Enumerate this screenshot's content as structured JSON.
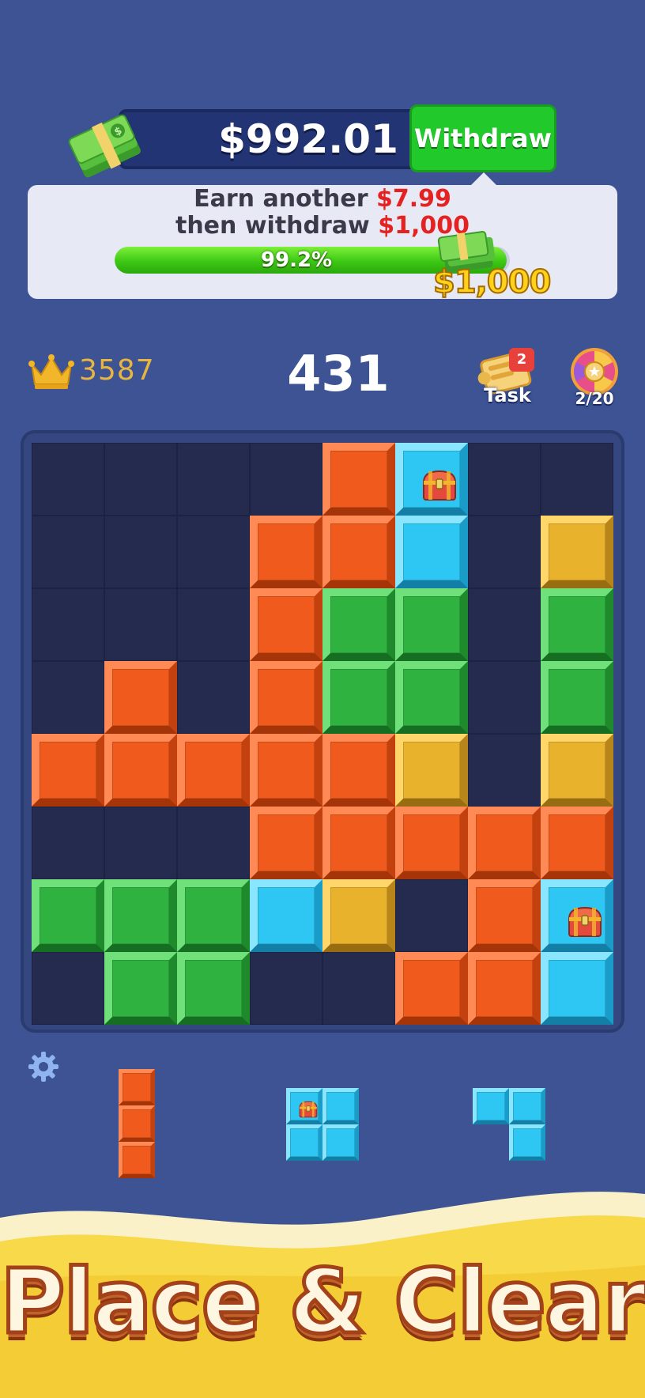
{
  "wallet": {
    "balance": "$992.01",
    "withdraw_label": "Withdraw"
  },
  "progress": {
    "line1_prefix": "Earn another",
    "line1_amount": "$7.99",
    "line2_prefix": "then withdraw",
    "line2_amount": "$1,000",
    "percent_label": "99.2%",
    "percent_value": 0.992,
    "goal_label": "$1,000"
  },
  "scores": {
    "best": "3587",
    "current": "431"
  },
  "task": {
    "label": "Task",
    "badge_count": "2"
  },
  "spin": {
    "label": "2/20"
  },
  "colors": {
    "background": "#3e5393",
    "board": "#242b4e",
    "orange": "#f05a1c",
    "blue": "#2ec6f2",
    "green": "#2fb23f",
    "yellow": "#e8b22c",
    "accent_green": "#21c92a",
    "text_red": "#e52222"
  },
  "board": {
    "rows": 8,
    "cols": 8,
    "legend": "O=orange, B=blue, G=green, Y=yellow, C=blue with treasure chest, .=empty",
    "grid": [
      "....OC..",
      "...OOB.Y",
      "...OGG.G",
      ".O.OGG.G",
      "OOOOOY.Y",
      "...OOOOO",
      "GGGBY.OC",
      ".GG..OOB"
    ]
  },
  "tray": {
    "pieces": [
      {
        "name": "vertical-3-orange",
        "grid": [
          "O",
          "O",
          "O"
        ]
      },
      {
        "name": "square-blue-chest",
        "grid": [
          "CB",
          "BB"
        ]
      },
      {
        "name": "l-blue",
        "grid": [
          "BB",
          ".B"
        ]
      }
    ]
  },
  "banner": {
    "title": "Place & Clear"
  }
}
